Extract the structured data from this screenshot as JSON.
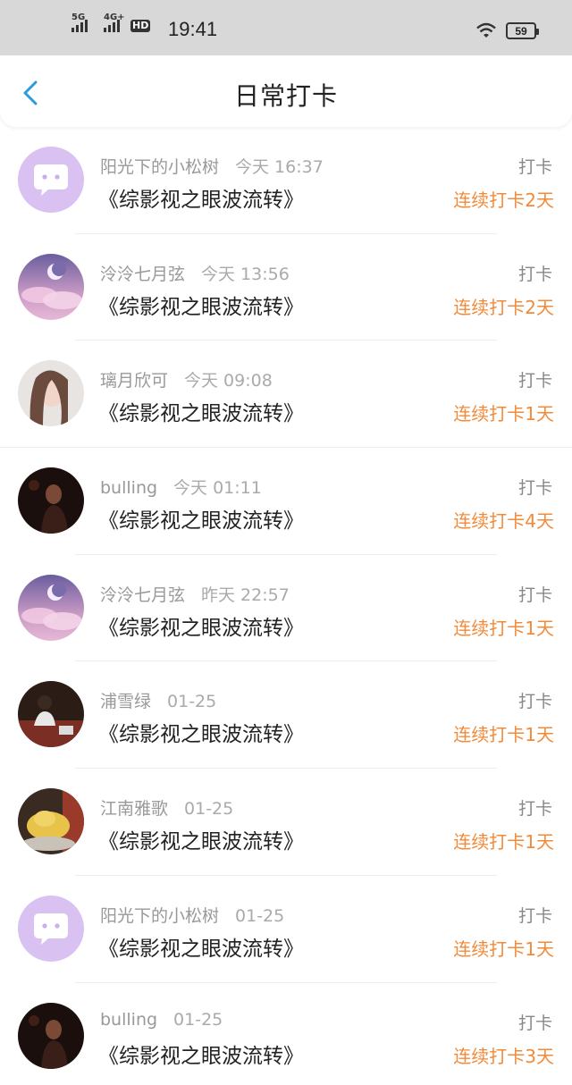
{
  "status_bar": {
    "net1": "5G",
    "net2": "4G+",
    "hd": "HD",
    "time": "19:41",
    "battery": "59"
  },
  "header": {
    "title": "日常打卡"
  },
  "items": [
    {
      "name": "阳光下的小松树",
      "time": "今天 16:37",
      "book": "《综影视之眼波流转》",
      "checkin": "打卡",
      "streak": "连续打卡2天",
      "avatar": "purple-chat-icon"
    },
    {
      "name": "泠泠七月弦",
      "time": "今天 13:56",
      "book": "《综影视之眼波流转》",
      "checkin": "打卡",
      "streak": "连续打卡2天",
      "avatar": "moon-night-image"
    },
    {
      "name": "璃月欣可",
      "time": "今天 09:08",
      "book": "《综影视之眼波流转》",
      "checkin": "打卡",
      "streak": "连续打卡1天",
      "avatar": "portrait-photo"
    },
    {
      "name": "bulling",
      "time": "今天 01:11",
      "book": "《综影视之眼波流转》",
      "checkin": "打卡",
      "streak": "连续打卡4天",
      "avatar": "dark-portrait-photo"
    },
    {
      "name": "泠泠七月弦",
      "time": "昨天 22:57",
      "book": "《综影视之眼波流转》",
      "checkin": "打卡",
      "streak": "连续打卡1天",
      "avatar": "moon-night-image"
    },
    {
      "name": "浦雪绿",
      "time": "01-25",
      "book": "《综影视之眼波流转》",
      "checkin": "打卡",
      "streak": "连续打卡1天",
      "avatar": "restaurant-photo"
    },
    {
      "name": "江南雅歌",
      "time": "01-25",
      "book": "《综影视之眼波流转》",
      "checkin": "打卡",
      "streak": "连续打卡1天",
      "avatar": "yellow-plush-photo"
    },
    {
      "name": "阳光下的小松树",
      "time": "01-25",
      "book": "《综影视之眼波流转》",
      "checkin": "打卡",
      "streak": "连续打卡1天",
      "avatar": "purple-chat-icon"
    },
    {
      "name": "bulling",
      "time": "01-25",
      "book": "《综影视之眼波流转》",
      "checkin": "打卡",
      "streak": "连续打卡3天",
      "avatar": "dark-portrait-photo"
    }
  ],
  "colors": {
    "accent_orange": "#f28a3a",
    "back_blue": "#2a9bdb",
    "status_bg": "#d8d8d8",
    "avatar_purple": "#d9c2f2"
  }
}
